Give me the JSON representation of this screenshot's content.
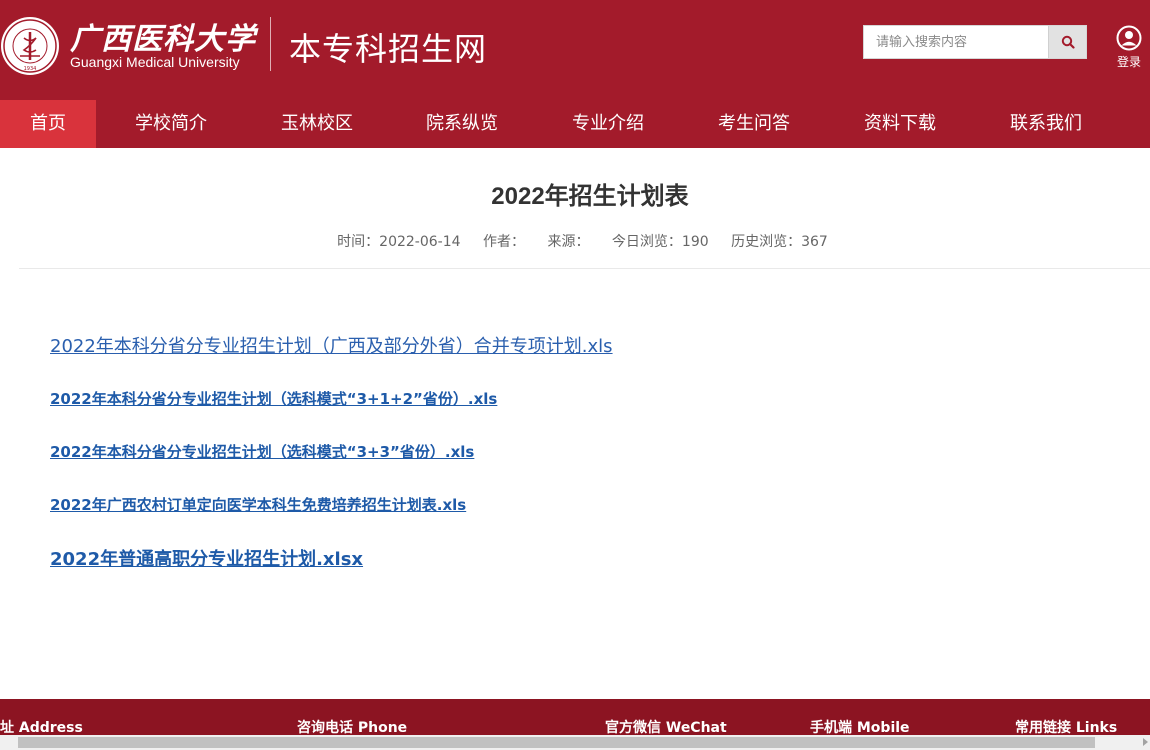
{
  "header": {
    "logo": {
      "cn_name": "广西医科大学",
      "en_name": "Guangxi Medical University",
      "seal_text": "广西医科大学 GUANGXI MEDICAL UNIVERSITY",
      "seal_year": "1934"
    },
    "site_title": "本专科招生网",
    "search": {
      "placeholder": "请输入搜索内容",
      "icon": "search-icon"
    },
    "login": {
      "label": "登录",
      "icon": "user-icon"
    }
  },
  "nav": {
    "items": [
      {
        "label": "首页",
        "active": true
      },
      {
        "label": "学校简介",
        "active": false
      },
      {
        "label": "玉林校区",
        "active": false
      },
      {
        "label": "院系纵览",
        "active": false
      },
      {
        "label": "专业介绍",
        "active": false
      },
      {
        "label": "考生问答",
        "active": false
      },
      {
        "label": "资料下载",
        "active": false
      },
      {
        "label": "联系我们",
        "active": false
      }
    ]
  },
  "article": {
    "title": "2022年招生计划表",
    "meta": {
      "time": "时间：2022-06-14",
      "author": "作者：",
      "source": "来源：",
      "today_views": "今日浏览：190",
      "history_views": "历史浏览：367"
    },
    "attachments": [
      "2022年本科分省分专业招生计划（广西及部分外省）合并专项计划.xls",
      "2022年本科分省分专业招生计划（选科模式“3+1+2”省份）.xls",
      "2022年本科分省分专业招生计划（选科模式“3+3”省份）.xls",
      "2022年广西农村订单定向医学本科生免费培养招生计划表.xls",
      "2022年普通高职分专业招生计划.xlsx"
    ]
  },
  "footer": {
    "columns": [
      "地址 Address",
      "咨询电话 Phone",
      "官方微信 WeChat",
      "手机端 Mobile",
      "常用链接 Links"
    ]
  },
  "colors": {
    "brand_red": "#a31b2b",
    "nav_active": "#d9333c",
    "footer_red": "#8c1422",
    "link_blue": "#1e5aa8"
  }
}
